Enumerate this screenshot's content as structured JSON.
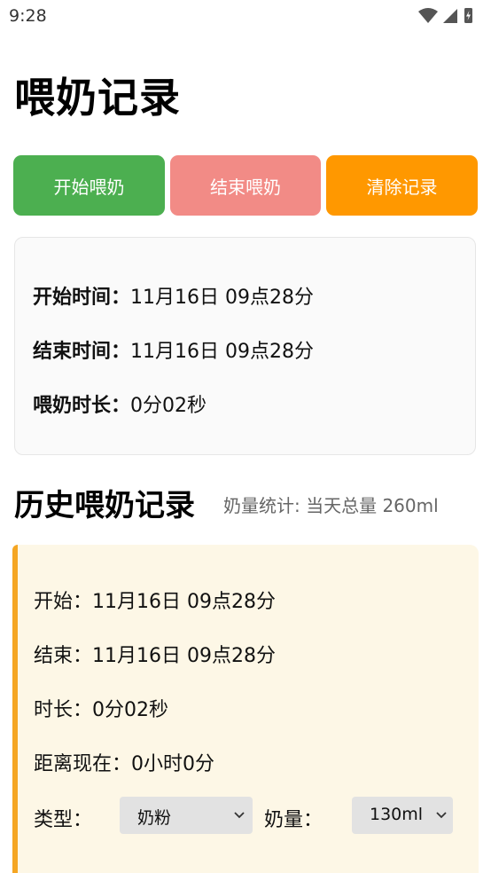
{
  "status_bar": {
    "time": "9:28"
  },
  "page": {
    "title": "喂奶记录"
  },
  "actions": {
    "start_label": "开始喂奶",
    "end_label": "结束喂奶",
    "clear_label": "清除记录"
  },
  "current": {
    "start_key": "开始时间：",
    "start_val": "11月16日 09点28分",
    "end_key": "结束时间：",
    "end_val": "11月16日 09点28分",
    "duration_key": "喂奶时长：",
    "duration_val": "0分02秒"
  },
  "history": {
    "title": "历史喂奶记录",
    "stats": "奶量统计: 当天总量 260ml",
    "record": {
      "start": "开始：11月16日 09点28分",
      "end": "结束：11月16日 09点28分",
      "duration": "时长：0分02秒",
      "since": "距离现在：0小时0分",
      "type_label": "类型：",
      "type_value": "奶粉",
      "amount_label": "奶量：",
      "amount_value": "130ml"
    }
  },
  "colors": {
    "start": "#4caf50",
    "end": "#f28b86",
    "clear": "#ff9800",
    "record_bg": "#fdf7e6",
    "record_accent": "#f5a623"
  }
}
